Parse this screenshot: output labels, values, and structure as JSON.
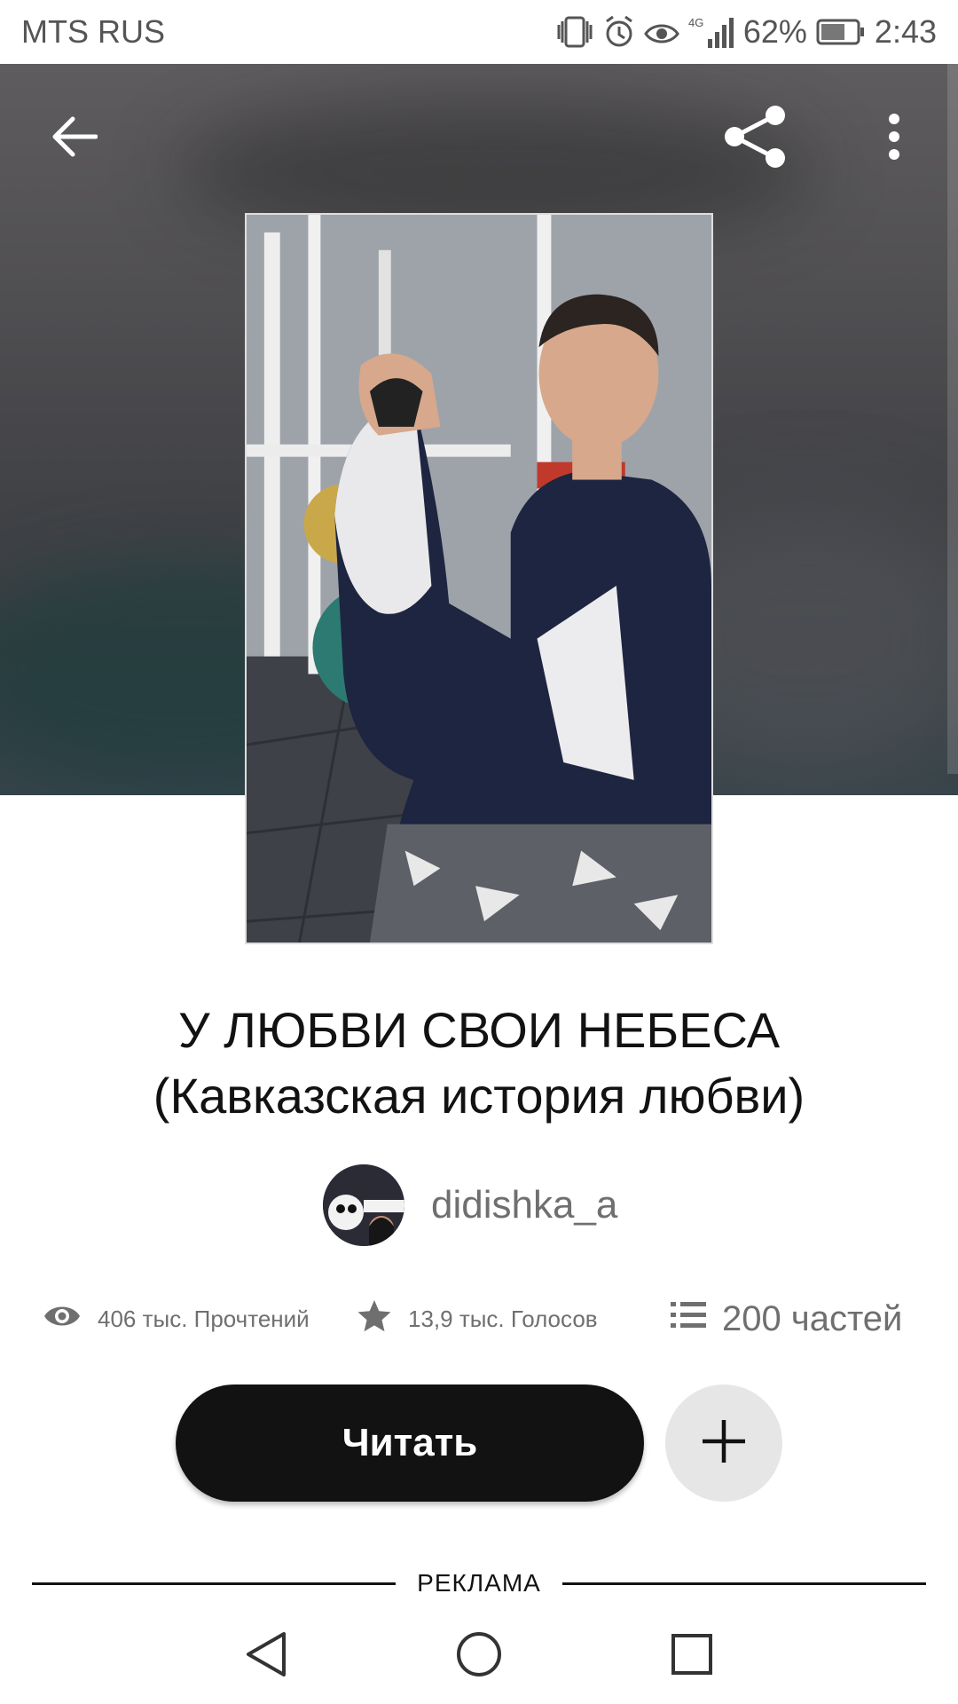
{
  "status_bar": {
    "carrier": "MTS RUS",
    "network": "4G",
    "battery": "62%",
    "time": "2:43"
  },
  "header": {
    "icons": [
      "back-arrow-icon",
      "share-icon",
      "more-vert-icon"
    ]
  },
  "story": {
    "title_line1": "У ЛЮБВИ СВОИ НЕБЕСА",
    "title_line2": "(Кавказская история любви)",
    "author": "didishka_a",
    "reads": "406 тыс. Прочтений",
    "votes": "13,9 тыс. Голосов",
    "parts": "200 частей"
  },
  "actions": {
    "read_label": "Читать"
  },
  "ad": {
    "label": "РЕКЛАМА"
  },
  "colors": {
    "primary_button": "#121212",
    "secondary_button": "#e6e6e6",
    "muted_text": "#6f6f6f"
  }
}
